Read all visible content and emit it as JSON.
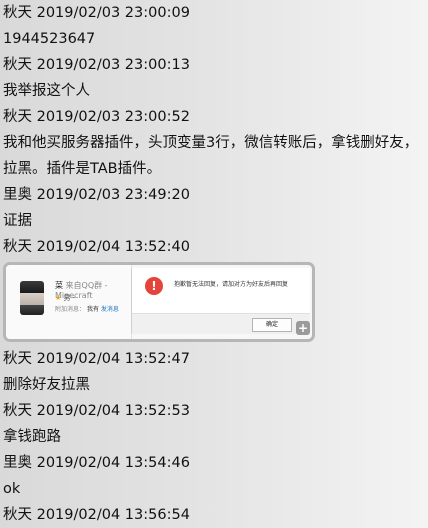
{
  "messages": [
    {
      "header": "秋天 2019/02/03 23:00:09",
      "body": "1944523647"
    },
    {
      "header": "秋天 2019/02/03 23:00:13",
      "body": "我举报这个人"
    },
    {
      "header": "秋天 2019/02/03 23:00:52",
      "body": "我和他买服务器插件，头顶变量3行，微信转账后，拿钱删好友，拉黑。插件是TAB插件。"
    },
    {
      "header": "里奥 2019/02/03 23:49:20",
      "body": "证据"
    },
    {
      "header": "秋天 2019/02/04 13:52:40"
    },
    {
      "header": "秋天 2019/02/04 13:52:47",
      "body": "删除好友拉黑"
    },
    {
      "header": "秋天 2019/02/04 13:52:53",
      "body": "拿钱跑路"
    },
    {
      "header": "里奥 2019/02/04 13:54:46",
      "body": "ok"
    },
    {
      "header": "秋天 2019/02/04 13:56:54"
    }
  ],
  "screenshot": {
    "profile_name": "菜",
    "profile_name_suffix": "来自QQ群 - Minecraft",
    "profile_gender": "男 -",
    "profile_msg_prefix": "附加消息：",
    "profile_msg_owner": "我有",
    "profile_msg_link": "发消息",
    "dialog_icon": "!",
    "dialog_text": "抱歉暂无法回复，请加对方为好友后再回复",
    "ok_button": "确定",
    "plus_badge": "+"
  },
  "colors": {
    "background": "#e3e3e3",
    "error_icon": "#e4443a",
    "link": "#1c72c4"
  }
}
